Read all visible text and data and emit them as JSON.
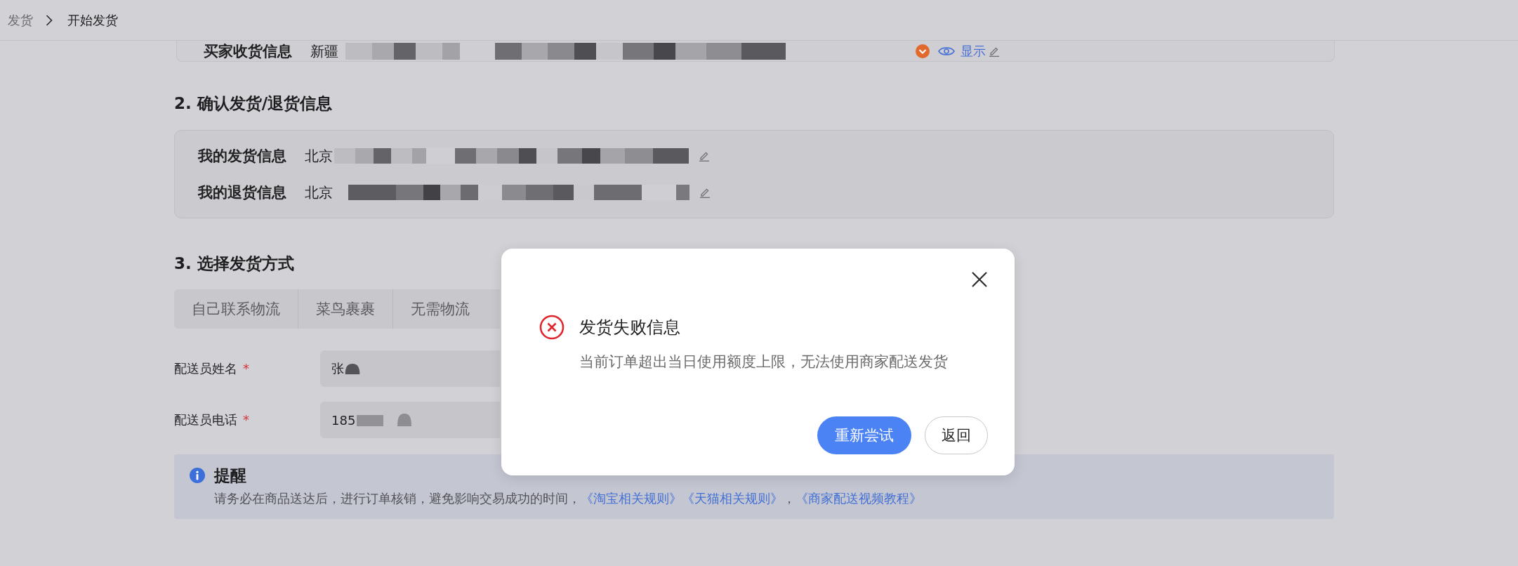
{
  "breadcrumb": [
    {
      "label": "发货",
      "current": false
    },
    {
      "label": "开始发货",
      "current": true
    }
  ],
  "buyer_info": {
    "label": "买家收货信息",
    "address": "新疆",
    "toggle": "显示"
  },
  "confirm": {
    "title": "2. 确认发货/退货信息",
    "rows": [
      {
        "label": "我的发货信息",
        "address": "北京"
      },
      {
        "label": "我的退货信息",
        "address": "北京"
      }
    ]
  },
  "method": {
    "title": "3. 选择发货方式",
    "tabs": [
      {
        "label": "自己联系物流",
        "selected": false
      },
      {
        "label": "菜鸟裹裹",
        "selected": false
      },
      {
        "label": "无需物流",
        "selected": false
      }
    ],
    "fields": [
      {
        "label": "配送员姓名",
        "required_mark": "*",
        "value": "张"
      },
      {
        "label": "配送员电话",
        "required_mark": "*",
        "value": "185"
      }
    ]
  },
  "reminder": {
    "title": "提醒",
    "segments": [
      {
        "kind": "text",
        "text": "请务必在商品送达后，进行订单核销，避免影响交易成功的时间，"
      },
      {
        "kind": "link",
        "text": "《淘宝相关规则》"
      },
      {
        "kind": "link",
        "text": "《天猫相关规则》"
      },
      {
        "kind": "text",
        "text": "，"
      },
      {
        "kind": "link",
        "text": "《商家配送视频教程》"
      }
    ]
  },
  "dialog": {
    "title": "发货失败信息",
    "message": "当前订单超出当日使用额度上限，无法使用商家配送发货",
    "buttons": [
      {
        "label": "重新尝试",
        "kind": "primary"
      },
      {
        "label": "返回",
        "kind": "secondary"
      }
    ]
  }
}
